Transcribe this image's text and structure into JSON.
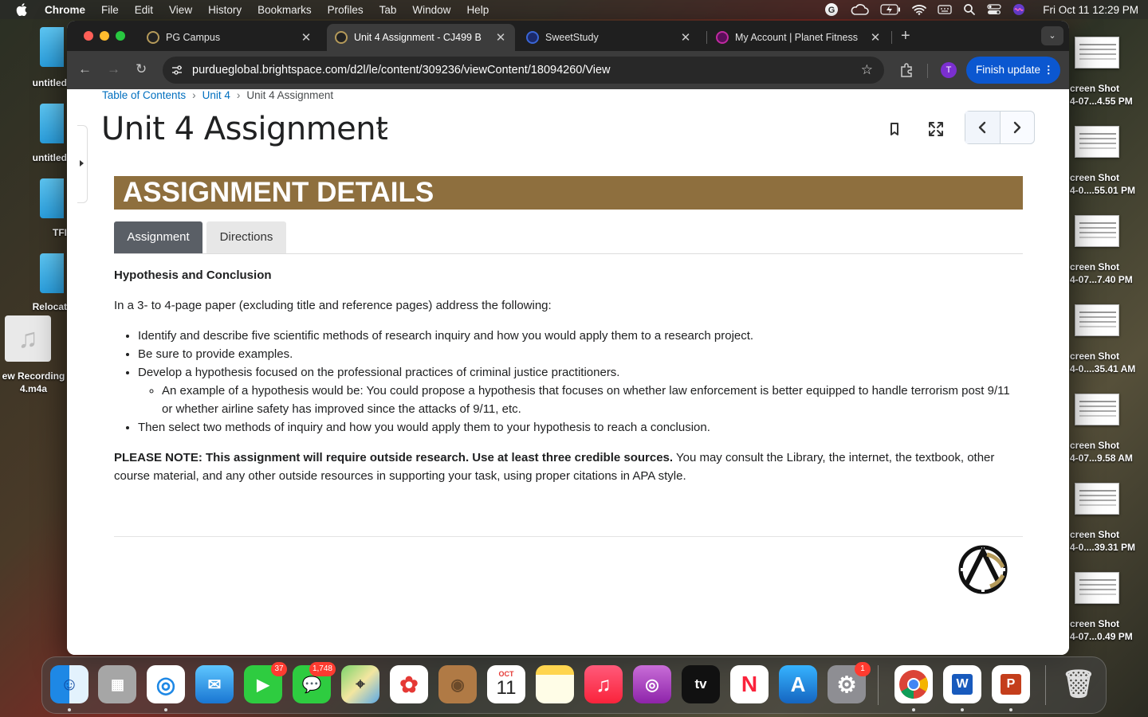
{
  "menubar": {
    "app": "Chrome",
    "items": [
      "File",
      "Edit",
      "View",
      "History",
      "Bookmarks",
      "Profiles",
      "Tab",
      "Window",
      "Help"
    ],
    "clock": "Fri Oct 11  12:29 PM"
  },
  "desktop_left": {
    "items": [
      "untitled",
      "untitled",
      "TFI",
      "Relocat"
    ],
    "recording_label": "ew Recording 4.m4a"
  },
  "desktop_right": {
    "shots": [
      {
        "l1": "creen Shot",
        "l2": "4-07...4.55 PM"
      },
      {
        "l1": "creen Shot",
        "l2": "4-0....55.01 PM"
      },
      {
        "l1": "creen Shot",
        "l2": "4-07...7.40 PM"
      },
      {
        "l1": "creen Shot",
        "l2": "4-0....35.41 AM"
      },
      {
        "l1": "creen Shot",
        "l2": "4-07...9.58 AM"
      },
      {
        "l1": "creen Shot",
        "l2": "4-0....39.31 PM"
      },
      {
        "l1": "creen Shot",
        "l2": "4-07...0.49 PM"
      }
    ]
  },
  "browser": {
    "tabs": [
      {
        "title": "PG Campus",
        "active": false
      },
      {
        "title": "Unit 4 Assignment - CJ499 B",
        "active": true
      },
      {
        "title": "SweetStudy",
        "active": false
      },
      {
        "title": "My Account | Planet Fitness",
        "active": false
      }
    ],
    "url": "purdueglobal.brightspace.com/d2l/le/content/309236/viewContent/18094260/View",
    "profile_initial": "T",
    "finish_update": "Finish update"
  },
  "page": {
    "breadcrumb": [
      "Table of Contents",
      "Unit 4",
      "Unit 4 Assignment"
    ],
    "title": "Unit 4 Assignment",
    "banner": "ASSIGNMENT DETAILS",
    "content_tabs": [
      "Assignment",
      "Directions"
    ],
    "heading": "Hypothesis and Conclusion",
    "intro": "In a 3- to 4-page paper (excluding title and reference pages) address the following:",
    "bullets": [
      "Identify and describe five scientific methods of research inquiry and how you would apply them to a research project.",
      "Be sure to provide examples.",
      "Develop a hypothesis focused on the professional practices of criminal justice practitioners."
    ],
    "sub_bullet": "An example of a hypothesis would be: You could propose a hypothesis that focuses on whether law enforcement is better equipped to handle terrorism post 9/11 or whether airline safety has improved since the attacks of 9/11, etc.",
    "last_bullet": "Then select two methods of inquiry and how you would apply them to your hypothesis to reach a conclusion.",
    "note_bold": "PLEASE NOTE: This assignment will require outside research. Use at least three credible sources.",
    "note_rest": " You may consult the Library, the internet, the textbook, other course material, and any other outside resources in supporting your task, using proper citations in APA style."
  },
  "dock": {
    "facetime_badge": "37",
    "messages_badge": "1,748",
    "calendar_month": "OCT",
    "calendar_day": "11",
    "tv_label": "tv",
    "settings_badge": "1"
  }
}
